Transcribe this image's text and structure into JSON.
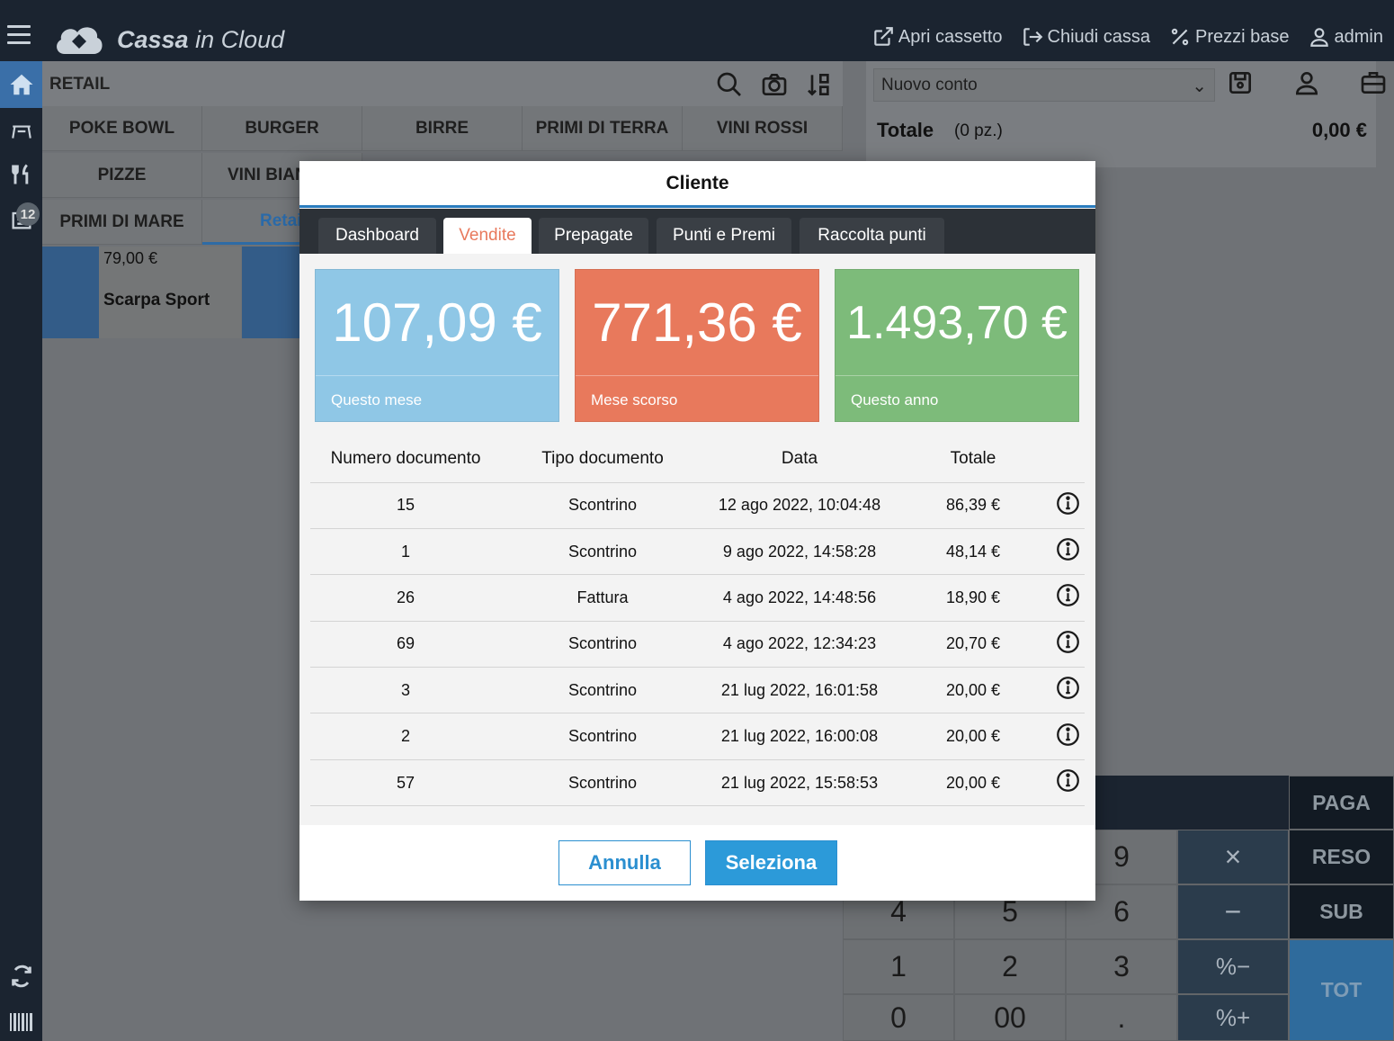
{
  "app": {
    "logo_bold": "Cassa",
    "logo_rest": " in Cloud",
    "top_actions": [
      "Apri cassetto",
      "Chiudi cassa",
      "Prezzi base",
      "admin"
    ]
  },
  "leftnav": {
    "badge": "12"
  },
  "main": {
    "section_title": "RETAIL",
    "categories": [
      "POKE BOWL",
      "BURGER",
      "BIRRE",
      "PRIMI DI TERRA",
      "VINI ROSSI",
      "PIZZE",
      "VINI BIAN",
      "PRIMI DI MARE",
      "Retai"
    ],
    "product": {
      "price": "79,00 €",
      "name": "Scarpa Sport"
    }
  },
  "right": {
    "conto": "Nuovo conto",
    "totale_label": "Totale",
    "totale_pz": "(0 pz.)",
    "totale_value": "0,00 €"
  },
  "keypad": {
    "digits": [
      "9",
      "4",
      "5",
      "6",
      "1",
      "2",
      "3",
      "0",
      "00",
      "."
    ],
    "ops": [
      "×",
      "−",
      "%−",
      "%+"
    ],
    "side": [
      "PAGA",
      "RESO",
      "SUB",
      "TOT"
    ]
  },
  "modal": {
    "title": "Cliente",
    "tabs": [
      "Dashboard",
      "Vendite",
      "Prepagate",
      "Punti e Premi",
      "Raccolta punti"
    ],
    "active_tab": "Vendite",
    "stats": [
      {
        "value": "107,09 €",
        "label": "Questo mese",
        "color": "#8fc7e6"
      },
      {
        "value": "771,36 €",
        "label": "Mese scorso",
        "color": "#e8795c"
      },
      {
        "value": "1.493,70 €",
        "label": "Questo anno",
        "color": "#7dbb7a"
      }
    ],
    "columns": [
      "Numero documento",
      "Tipo documento",
      "Data",
      "Totale"
    ],
    "rows": [
      [
        "15",
        "Scontrino",
        "12 ago 2022, 10:04:48",
        "86,39 €"
      ],
      [
        "1",
        "Scontrino",
        "9 ago 2022, 14:58:28",
        "48,14 €"
      ],
      [
        "26",
        "Fattura",
        "4 ago 2022, 14:48:56",
        "18,90 €"
      ],
      [
        "69",
        "Scontrino",
        "4 ago 2022, 12:34:23",
        "20,70 €"
      ],
      [
        "3",
        "Scontrino",
        "21 lug 2022, 16:01:58",
        "20,00 €"
      ],
      [
        "2",
        "Scontrino",
        "21 lug 2022, 16:00:08",
        "20,00 €"
      ],
      [
        "57",
        "Scontrino",
        "21 lug 2022, 15:58:53",
        "20,00 €"
      ]
    ],
    "cancel_label": "Annulla",
    "select_label": "Seleziona"
  }
}
